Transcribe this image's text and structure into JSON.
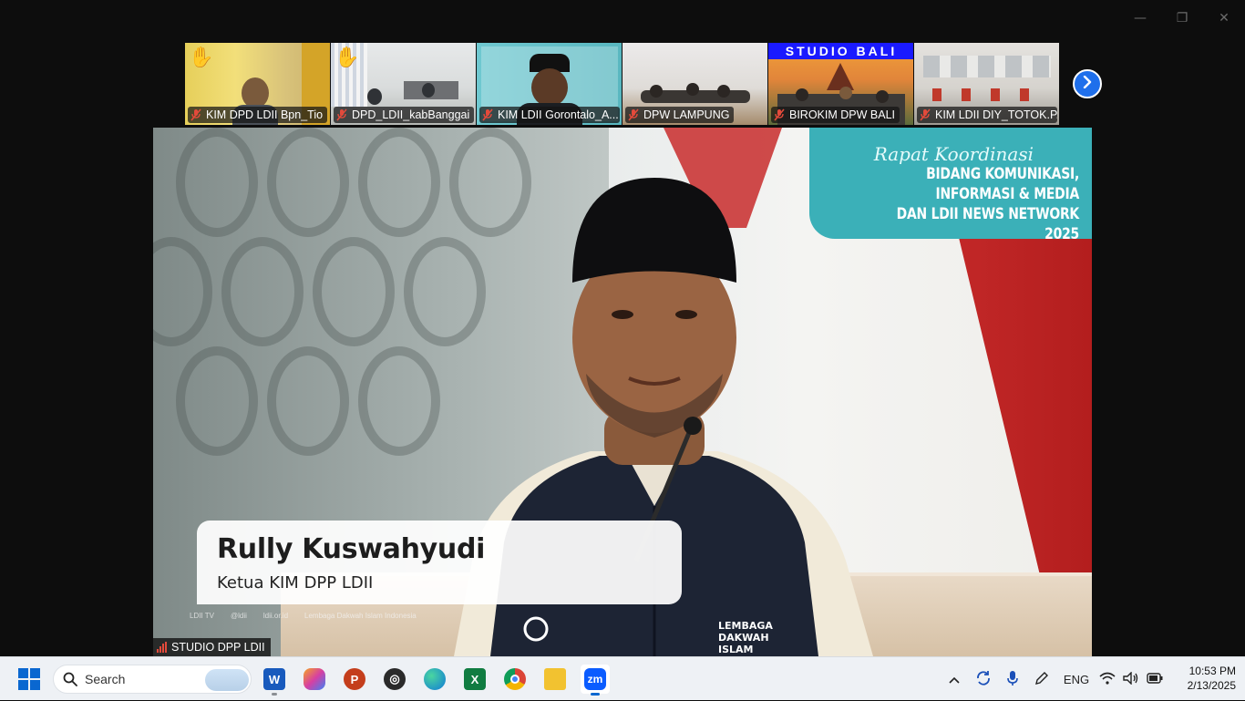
{
  "window": {
    "controls": {
      "minimize": "—",
      "maximize": "❐",
      "close": "✕"
    }
  },
  "gallery": {
    "tiles": [
      {
        "name": "KIM DPD LDII Bpn_Tio",
        "raised_hand": true,
        "muted": true
      },
      {
        "name": "DPD_LDII_kabBanggai",
        "raised_hand": true,
        "muted": true
      },
      {
        "name": "KIM LDII Gorontalo_A...",
        "raised_hand": false,
        "muted": true
      },
      {
        "name": "DPW LAMPUNG",
        "raised_hand": false,
        "muted": true
      },
      {
        "name": "BIROKIM DPW BALI",
        "raised_hand": false,
        "muted": true,
        "banner": "STUDIO BALI"
      },
      {
        "name": "KIM LDII DIY_TOTOK.P...",
        "raised_hand": false,
        "muted": true
      }
    ],
    "next_icon": "chevron-right-icon"
  },
  "main_video": {
    "banner": {
      "line1": "Rapat Koordinasi",
      "line2": "BIDANG KOMUNIKASI, INFORMASI & MEDIA",
      "line3": "DAN LDII NEWS NETWORK 2025"
    },
    "lower_third": {
      "name": "Rully Kuswahyudi",
      "title": "Ketua KIM DPP LDII"
    },
    "social": [
      "LDII TV",
      "@ldii",
      "ldii.or.id",
      "Lembaga Dakwah Islam Indonesia"
    ],
    "vest_text": "LEMBAGA DAKWAH ISLAM INDONESIA",
    "speaker_label": "STUDIO DPP LDII"
  },
  "taskbar": {
    "search_label": "Search",
    "apps": [
      "word-icon",
      "copilot-icon",
      "powerpoint-icon",
      "app-icon",
      "edge-icon",
      "excel-icon",
      "chrome-icon",
      "file-explorer-icon",
      "zoom-icon"
    ],
    "zoom_label": "zm",
    "language": "ENG",
    "time": "10:53 PM",
    "date": "2/13/2025",
    "colors": {
      "accent": "#0a67d0",
      "zoom": "#0b5cff"
    }
  }
}
